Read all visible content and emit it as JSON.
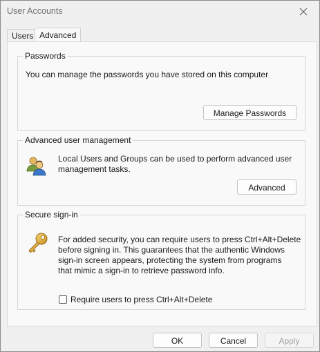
{
  "window": {
    "title": "User Accounts",
    "close_icon": "close-icon"
  },
  "tabs": [
    {
      "label": "Users",
      "selected": false
    },
    {
      "label": "Advanced",
      "selected": true
    }
  ],
  "passwords": {
    "title": "Passwords",
    "description": "You can manage the passwords you have stored on this computer",
    "button_label": "Manage Passwords"
  },
  "advanced_user_management": {
    "title": "Advanced user management",
    "description_line1": "Local Users and Groups can be used to perform advanced user",
    "description_line2": "management tasks.",
    "button_label": "Advanced",
    "icon": "users-group-icon"
  },
  "secure_signin": {
    "title": "Secure sign-in",
    "description_lines": [
      "For added security, you can require users to press Ctrl+Alt+Delete",
      "before signing in. This guarantees that the authentic Windows",
      "sign-in screen appears, protecting the system from programs",
      "that mimic a sign-in to retrieve password info."
    ],
    "checkbox_label": "Require users to press Ctrl+Alt+Delete",
    "checkbox_checked": false,
    "icon": "key-icon"
  },
  "footer": {
    "ok_label": "OK",
    "cancel_label": "Cancel",
    "apply_label": "Apply",
    "apply_enabled": false
  }
}
